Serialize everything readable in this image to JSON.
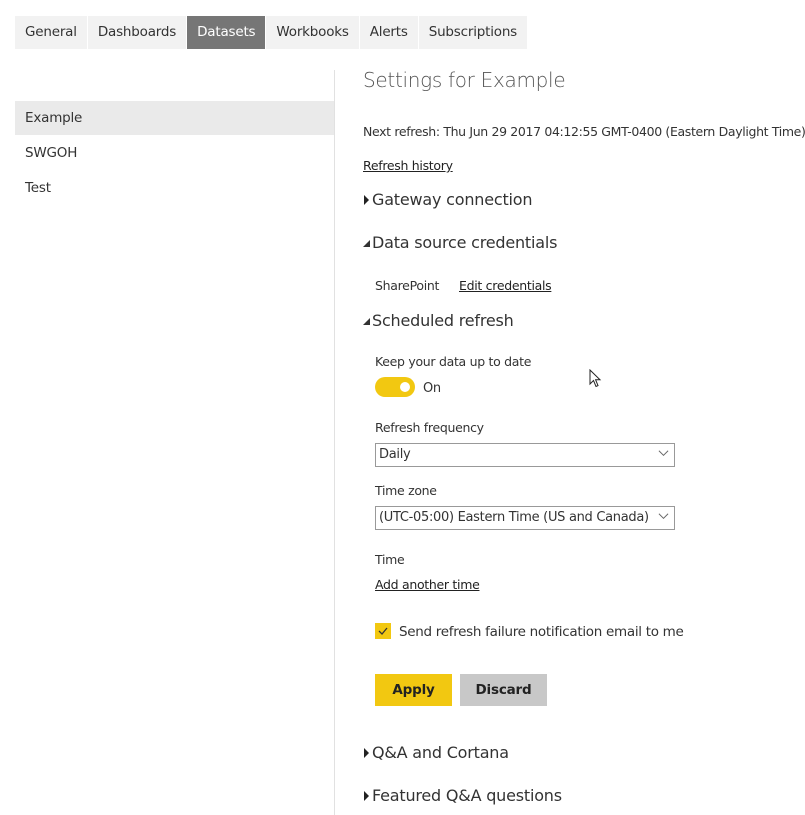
{
  "tabs": [
    {
      "label": "General",
      "active": false
    },
    {
      "label": "Dashboards",
      "active": false
    },
    {
      "label": "Datasets",
      "active": true
    },
    {
      "label": "Workbooks",
      "active": false
    },
    {
      "label": "Alerts",
      "active": false
    },
    {
      "label": "Subscriptions",
      "active": false
    }
  ],
  "sidebar": {
    "items": [
      {
        "label": "Example",
        "selected": true
      },
      {
        "label": "SWGOH",
        "selected": false
      },
      {
        "label": "Test",
        "selected": false
      }
    ]
  },
  "main": {
    "title": "Settings for Example",
    "next_refresh": "Next refresh: Thu Jun 29 2017 04:12:55 GMT-0400 (Eastern Daylight Time)",
    "refresh_history_link": "Refresh history",
    "sections": {
      "gateway": {
        "label": "Gateway connection",
        "expanded": false
      },
      "credentials": {
        "label": "Data source credentials",
        "expanded": true,
        "source_name": "SharePoint",
        "edit_link": "Edit credentials"
      },
      "scheduled_refresh": {
        "label": "Scheduled refresh",
        "expanded": true,
        "keep_up_to_date_label": "Keep your data up to date",
        "toggle_state": "On",
        "toggle_on": true,
        "frequency_label": "Refresh frequency",
        "frequency_value": "Daily",
        "timezone_label": "Time zone",
        "timezone_value": "(UTC-05:00) Eastern Time (US and Canada)",
        "time_label": "Time",
        "add_time_link": "Add another time",
        "notify_checkbox_label": "Send refresh failure notification email to me",
        "notify_checked": true,
        "apply_label": "Apply",
        "discard_label": "Discard"
      },
      "qa_cortana": {
        "label": "Q&A and Cortana",
        "expanded": false
      },
      "featured_qa": {
        "label": "Featured Q&A questions",
        "expanded": false
      }
    }
  },
  "colors": {
    "accent": "#f2c811",
    "active_tab": "#767676",
    "selected_item": "#eaeaea",
    "secondary_button": "#c8c8c8"
  }
}
